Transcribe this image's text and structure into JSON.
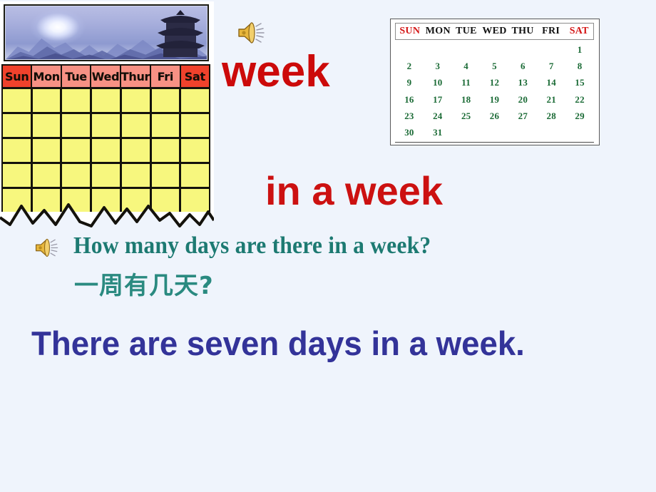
{
  "slide": {
    "background_color": "#eff4fc",
    "title_word": "week",
    "phrase": "in a week",
    "question_en": "How many days are there in a week?",
    "question_zh": "一周有几天?",
    "answer_en": "There are seven days in a week.",
    "colors": {
      "red_heading": "#cc0a0a",
      "teal_question": "#1d7a72",
      "indigo_answer": "#333399",
      "calendar_header_red": "#f0422c",
      "calendar_cell_yellow": "#f7f77e",
      "month_day_green": "#1b6b36",
      "month_weekend_red": "#d41616"
    }
  },
  "audio_buttons": [
    {
      "name": "speaker-week",
      "label": "speaker-icon"
    },
    {
      "name": "speaker-question",
      "label": "speaker-icon"
    }
  ],
  "wall_calendar": {
    "photo_caption": "snow mountains with pagoda",
    "weekdays": [
      "Sun",
      "Mon",
      "Tue",
      "Wed",
      "Thur",
      "Fri",
      "Sat"
    ],
    "weekday_shades": [
      "hot",
      "mild",
      "mild",
      "mild",
      "mild",
      "mild",
      "hot"
    ],
    "rows": 5,
    "columns": 7,
    "cells_empty": true,
    "torn_bottom_edge": true
  },
  "month_calendar": {
    "weekdays": [
      "SUN",
      "MON",
      "TUE",
      "WED",
      "THU",
      "FRI",
      "SAT"
    ],
    "weekend_indices": [
      0,
      6
    ],
    "weeks": [
      [
        "",
        "",
        "",
        "",
        "",
        "",
        "1"
      ],
      [
        "2",
        "3",
        "4",
        "5",
        "6",
        "7",
        "8"
      ],
      [
        "9",
        "10",
        "11",
        "12",
        "13",
        "14",
        "15"
      ],
      [
        "16",
        "17",
        "18",
        "19",
        "20",
        "21",
        "22"
      ],
      [
        "23",
        "24",
        "25",
        "26",
        "27",
        "28",
        "29"
      ],
      [
        "30",
        "31",
        "",
        "",
        "",
        "",
        ""
      ]
    ],
    "days_in_month": 31,
    "first_day_of_month": "SAT"
  }
}
